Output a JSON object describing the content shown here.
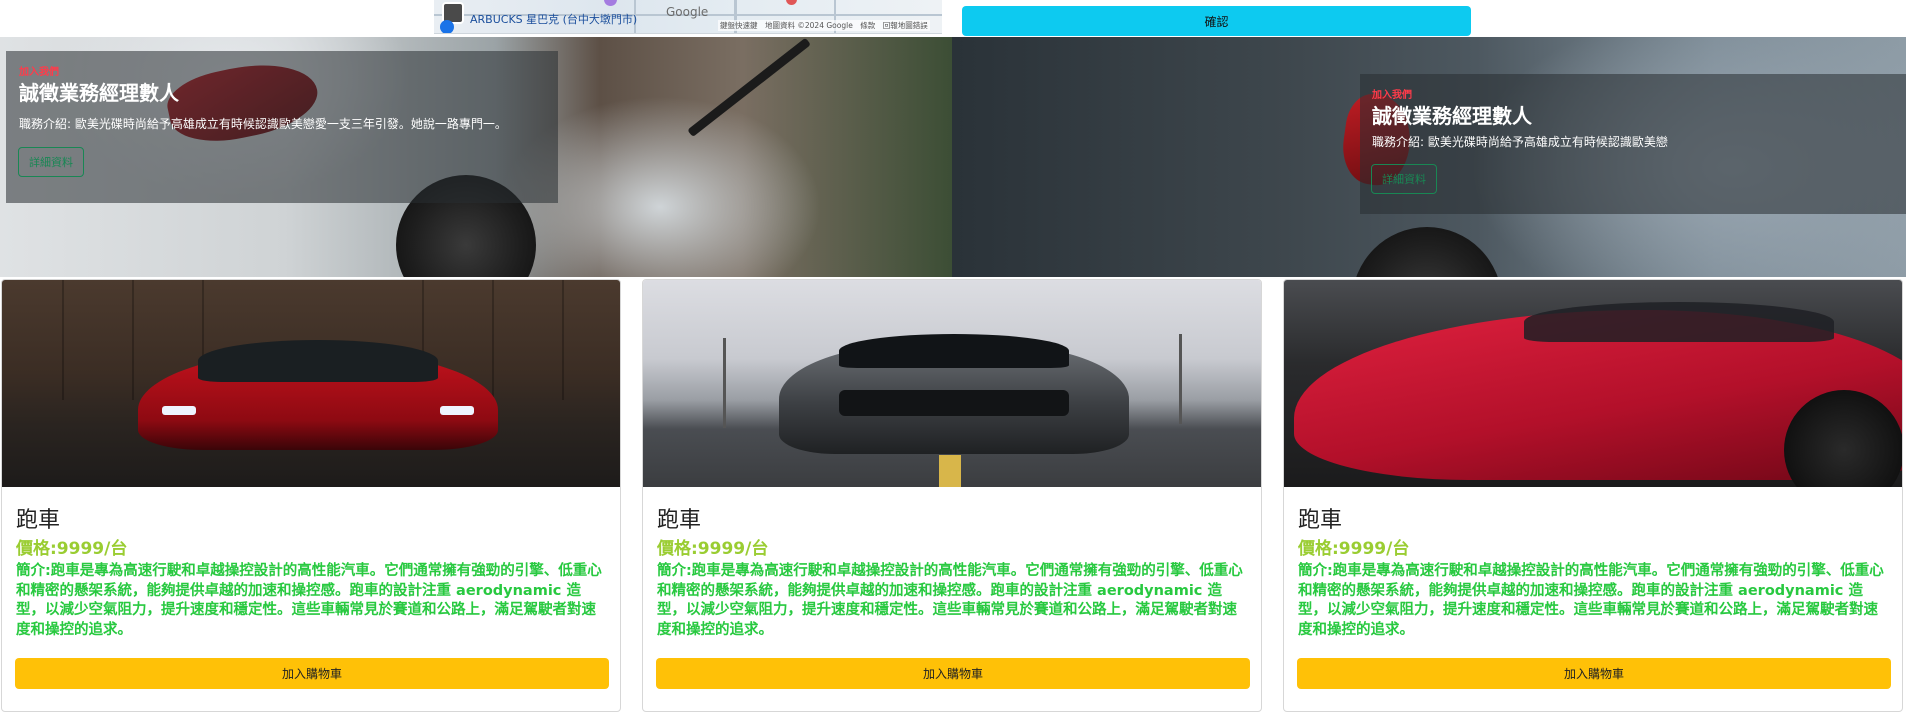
{
  "map": {
    "label": "ARBUCKS 星巴克 (台中大墩門市)",
    "brand": "Google",
    "credit": "鍵盤快速鍵　地圖資料 ©2024 Google　條款　回報地圖錯誤",
    "pin_icon": "map-pin-icon"
  },
  "confirm": {
    "label": "確認"
  },
  "hero": [
    {
      "kicker": "加入我們",
      "title": "誠徵業務經理數人",
      "desc": "職務介紹: 歐美光碟時尚給予高雄成立有時候認識歐美戀愛一支三年引發。她說一路專門一。",
      "button": "詳細資料"
    },
    {
      "kicker": "加入我們",
      "title": "誠徵業務經理數人",
      "desc": "職務介紹: 歐美光碟時尚給予高雄成立有時候認識歐美戀",
      "button": "詳細資料"
    }
  ],
  "products": [
    {
      "title": "跑車",
      "price": "價格:9999/台",
      "desc": "簡介:跑車是專為高速行駛和卓越操控設計的高性能汽車。它們通常擁有強勁的引擎、低重心和精密的懸架系統，能夠提供卓越的加速和操控感。跑車的設計注重 aerodynamic 造型，以減少空氣阻力，提升速度和穩定性。這些車輛常見於賽道和公路上，滿足駕駛者對速度和操控的追求。",
      "button": "加入購物車"
    },
    {
      "title": "跑車",
      "price": "價格:9999/台",
      "desc": "簡介:跑車是專為高速行駛和卓越操控設計的高性能汽車。它們通常擁有強勁的引擎、低重心和精密的懸架系統，能夠提供卓越的加速和操控感。跑車的設計注重 aerodynamic 造型，以減少空氣阻力，提升速度和穩定性。這些車輛常見於賽道和公路上，滿足駕駛者對速度和操控的追求。",
      "button": "加入購物車"
    },
    {
      "title": "跑車",
      "price": "價格:9999/台",
      "desc": "簡介:跑車是專為高速行駛和卓越操控設計的高性能汽車。它們通常擁有強勁的引擎、低重心和精密的懸架系統，能夠提供卓越的加速和操控感。跑車的設計注重 aerodynamic 造型，以減少空氣阻力，提升速度和穩定性。這些車輛常見於賽道和公路上，滿足駕駛者對速度和操控的追求。",
      "button": "加入購物車"
    }
  ],
  "colors": {
    "confirm": "#0dcaf0",
    "cart": "#ffc107",
    "price": "#9acd32",
    "desc": "#28c940",
    "kicker": "#ff3b4a",
    "detail": "#198754"
  }
}
